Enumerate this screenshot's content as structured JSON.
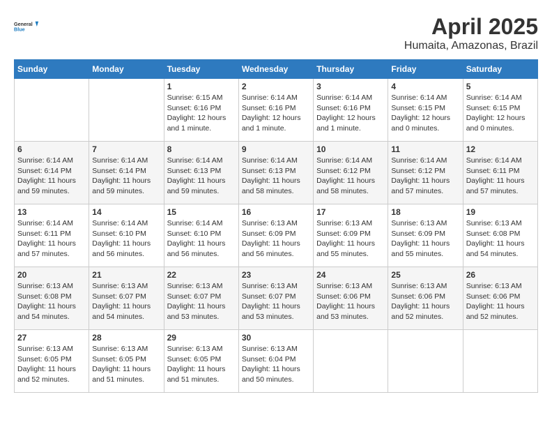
{
  "header": {
    "logo_line1": "General",
    "logo_line2": "Blue",
    "title": "April 2025",
    "subtitle": "Humaita, Amazonas, Brazil"
  },
  "weekdays": [
    "Sunday",
    "Monday",
    "Tuesday",
    "Wednesday",
    "Thursday",
    "Friday",
    "Saturday"
  ],
  "weeks": [
    [
      {
        "day": "",
        "sunrise": "",
        "sunset": "",
        "daylight": ""
      },
      {
        "day": "",
        "sunrise": "",
        "sunset": "",
        "daylight": ""
      },
      {
        "day": "1",
        "sunrise": "Sunrise: 6:15 AM",
        "sunset": "Sunset: 6:16 PM",
        "daylight": "Daylight: 12 hours and 1 minute."
      },
      {
        "day": "2",
        "sunrise": "Sunrise: 6:14 AM",
        "sunset": "Sunset: 6:16 PM",
        "daylight": "Daylight: 12 hours and 1 minute."
      },
      {
        "day": "3",
        "sunrise": "Sunrise: 6:14 AM",
        "sunset": "Sunset: 6:16 PM",
        "daylight": "Daylight: 12 hours and 1 minute."
      },
      {
        "day": "4",
        "sunrise": "Sunrise: 6:14 AM",
        "sunset": "Sunset: 6:15 PM",
        "daylight": "Daylight: 12 hours and 0 minutes."
      },
      {
        "day": "5",
        "sunrise": "Sunrise: 6:14 AM",
        "sunset": "Sunset: 6:15 PM",
        "daylight": "Daylight: 12 hours and 0 minutes."
      }
    ],
    [
      {
        "day": "6",
        "sunrise": "Sunrise: 6:14 AM",
        "sunset": "Sunset: 6:14 PM",
        "daylight": "Daylight: 11 hours and 59 minutes."
      },
      {
        "day": "7",
        "sunrise": "Sunrise: 6:14 AM",
        "sunset": "Sunset: 6:14 PM",
        "daylight": "Daylight: 11 hours and 59 minutes."
      },
      {
        "day": "8",
        "sunrise": "Sunrise: 6:14 AM",
        "sunset": "Sunset: 6:13 PM",
        "daylight": "Daylight: 11 hours and 59 minutes."
      },
      {
        "day": "9",
        "sunrise": "Sunrise: 6:14 AM",
        "sunset": "Sunset: 6:13 PM",
        "daylight": "Daylight: 11 hours and 58 minutes."
      },
      {
        "day": "10",
        "sunrise": "Sunrise: 6:14 AM",
        "sunset": "Sunset: 6:12 PM",
        "daylight": "Daylight: 11 hours and 58 minutes."
      },
      {
        "day": "11",
        "sunrise": "Sunrise: 6:14 AM",
        "sunset": "Sunset: 6:12 PM",
        "daylight": "Daylight: 11 hours and 57 minutes."
      },
      {
        "day": "12",
        "sunrise": "Sunrise: 6:14 AM",
        "sunset": "Sunset: 6:11 PM",
        "daylight": "Daylight: 11 hours and 57 minutes."
      }
    ],
    [
      {
        "day": "13",
        "sunrise": "Sunrise: 6:14 AM",
        "sunset": "Sunset: 6:11 PM",
        "daylight": "Daylight: 11 hours and 57 minutes."
      },
      {
        "day": "14",
        "sunrise": "Sunrise: 6:14 AM",
        "sunset": "Sunset: 6:10 PM",
        "daylight": "Daylight: 11 hours and 56 minutes."
      },
      {
        "day": "15",
        "sunrise": "Sunrise: 6:14 AM",
        "sunset": "Sunset: 6:10 PM",
        "daylight": "Daylight: 11 hours and 56 minutes."
      },
      {
        "day": "16",
        "sunrise": "Sunrise: 6:13 AM",
        "sunset": "Sunset: 6:09 PM",
        "daylight": "Daylight: 11 hours and 56 minutes."
      },
      {
        "day": "17",
        "sunrise": "Sunrise: 6:13 AM",
        "sunset": "Sunset: 6:09 PM",
        "daylight": "Daylight: 11 hours and 55 minutes."
      },
      {
        "day": "18",
        "sunrise": "Sunrise: 6:13 AM",
        "sunset": "Sunset: 6:09 PM",
        "daylight": "Daylight: 11 hours and 55 minutes."
      },
      {
        "day": "19",
        "sunrise": "Sunrise: 6:13 AM",
        "sunset": "Sunset: 6:08 PM",
        "daylight": "Daylight: 11 hours and 54 minutes."
      }
    ],
    [
      {
        "day": "20",
        "sunrise": "Sunrise: 6:13 AM",
        "sunset": "Sunset: 6:08 PM",
        "daylight": "Daylight: 11 hours and 54 minutes."
      },
      {
        "day": "21",
        "sunrise": "Sunrise: 6:13 AM",
        "sunset": "Sunset: 6:07 PM",
        "daylight": "Daylight: 11 hours and 54 minutes."
      },
      {
        "day": "22",
        "sunrise": "Sunrise: 6:13 AM",
        "sunset": "Sunset: 6:07 PM",
        "daylight": "Daylight: 11 hours and 53 minutes."
      },
      {
        "day": "23",
        "sunrise": "Sunrise: 6:13 AM",
        "sunset": "Sunset: 6:07 PM",
        "daylight": "Daylight: 11 hours and 53 minutes."
      },
      {
        "day": "24",
        "sunrise": "Sunrise: 6:13 AM",
        "sunset": "Sunset: 6:06 PM",
        "daylight": "Daylight: 11 hours and 53 minutes."
      },
      {
        "day": "25",
        "sunrise": "Sunrise: 6:13 AM",
        "sunset": "Sunset: 6:06 PM",
        "daylight": "Daylight: 11 hours and 52 minutes."
      },
      {
        "day": "26",
        "sunrise": "Sunrise: 6:13 AM",
        "sunset": "Sunset: 6:06 PM",
        "daylight": "Daylight: 11 hours and 52 minutes."
      }
    ],
    [
      {
        "day": "27",
        "sunrise": "Sunrise: 6:13 AM",
        "sunset": "Sunset: 6:05 PM",
        "daylight": "Daylight: 11 hours and 52 minutes."
      },
      {
        "day": "28",
        "sunrise": "Sunrise: 6:13 AM",
        "sunset": "Sunset: 6:05 PM",
        "daylight": "Daylight: 11 hours and 51 minutes."
      },
      {
        "day": "29",
        "sunrise": "Sunrise: 6:13 AM",
        "sunset": "Sunset: 6:05 PM",
        "daylight": "Daylight: 11 hours and 51 minutes."
      },
      {
        "day": "30",
        "sunrise": "Sunrise: 6:13 AM",
        "sunset": "Sunset: 6:04 PM",
        "daylight": "Daylight: 11 hours and 50 minutes."
      },
      {
        "day": "",
        "sunrise": "",
        "sunset": "",
        "daylight": ""
      },
      {
        "day": "",
        "sunrise": "",
        "sunset": "",
        "daylight": ""
      },
      {
        "day": "",
        "sunrise": "",
        "sunset": "",
        "daylight": ""
      }
    ]
  ]
}
